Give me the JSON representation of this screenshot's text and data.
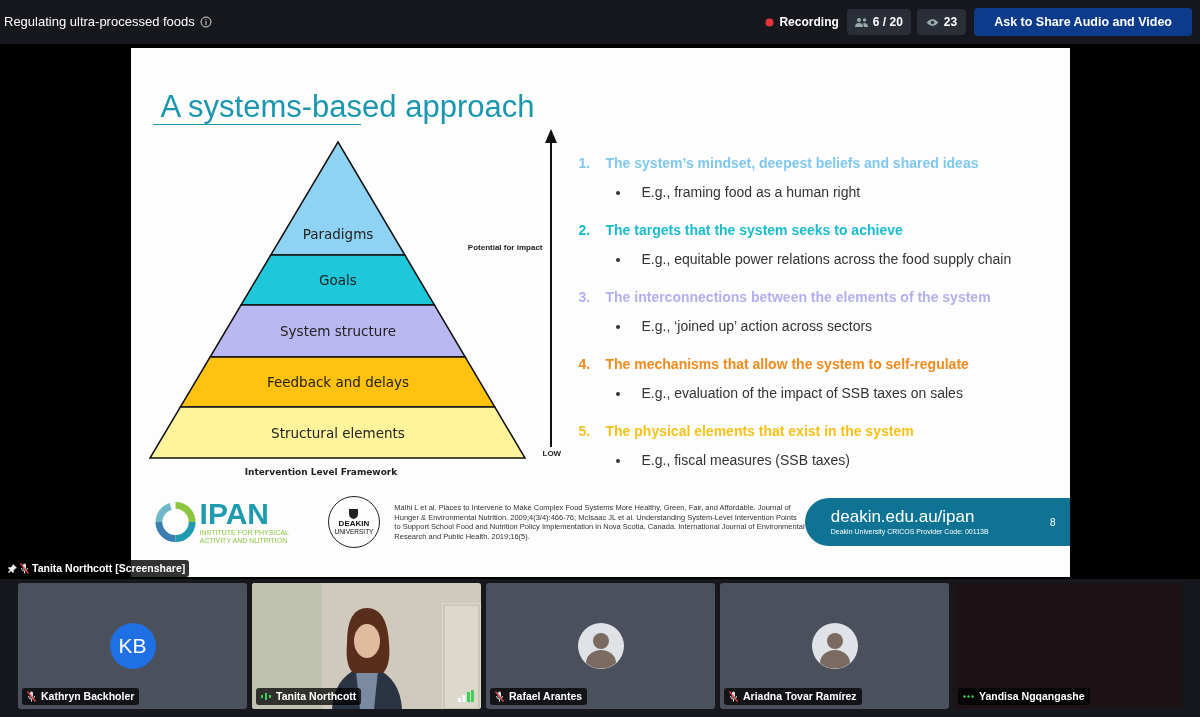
{
  "meeting": {
    "title": "Regulating ultra-processed foods",
    "recording": "Recording",
    "participants": "6 / 20",
    "viewers": "23",
    "share_button": "Ask to Share Audio and Video"
  },
  "slide": {
    "title": "A systems-based approach",
    "pyramid": [
      {
        "label": "Paradigms",
        "color": "#8fd3f4"
      },
      {
        "label": "Goals",
        "color": "#1ec8da"
      },
      {
        "label": "System structure",
        "color": "#bab8f0"
      },
      {
        "label": "Feedback and delays",
        "color": "#ffc20e"
      },
      {
        "label": "Structural elements",
        "color": "#fff39c"
      }
    ],
    "axis_label": "Potential for impact",
    "axis_low": "LOW",
    "caption": "Intervention Level Framework",
    "points": [
      {
        "number": "1.",
        "heading": "The system’s mindset, deepest beliefs and shared ideas",
        "example": "E.g., framing food as a human right",
        "color": "#7fc8ef"
      },
      {
        "number": "2.",
        "heading": "The targets that the system seeks to achieve",
        "example": "E.g., equitable power relations across the food supply chain",
        "color": "#19bccd"
      },
      {
        "number": "3.",
        "heading": "The interconnections between the elements of the system",
        "example": "E.g., ‘joined up’ action across sectors",
        "color": "#b2b0ec"
      },
      {
        "number": "4.",
        "heading": "The mechanisms that allow the system to self-regulate",
        "example": "E.g., evaluation of the impact of SSB taxes on sales",
        "color": "#f08a1c"
      },
      {
        "number": "5.",
        "heading": "The physical elements that exist in the system",
        "example": "E.g., fiscal measures (SSB taxes)",
        "color": "#f5c21a"
      }
    ],
    "ipan": "IPAN",
    "ipan_subtitle": "INSTITUTE FOR PHYSICAL ACTIVITY AND NUTRITION",
    "deakin": "DEAKIN",
    "deakin_sub": "UNIVERSITY",
    "references": "Malhi L et al. Places to Intervene to Make Complex Food Systems More Healthy, Green, Fair, and Affordable. Journal of Hunger & Environmental Nutrition. 2009;4(3/4):466-76; McIsaac JL et al. Understanding System-Level Intervention Points to Support School Food and Nutrition Policy Implementation in Nova Scotia, Canada. International Journal of Environmental Research and Public Health. 2019;16(5).",
    "url": "deakin.edu.au/ipan",
    "cricos": "Deakin University CRICOS Provider Code: 00113B",
    "page": "8"
  },
  "presenter_label": "Tanita Northcott [Screenshare]",
  "tiles": [
    {
      "name": "Kathryn Backholer",
      "kind": "initials",
      "initials": "KB",
      "muted": true,
      "speaking": false
    },
    {
      "name": "Tanita Northcott",
      "kind": "video",
      "muted": false,
      "speaking": true
    },
    {
      "name": "Rafael Arantes",
      "kind": "avatar",
      "muted": true,
      "speaking": false
    },
    {
      "name": "Ariadna Tovar Ramírez",
      "kind": "avatar",
      "muted": true,
      "speaking": false
    },
    {
      "name": "Yandisa Ngqangashe",
      "kind": "blank",
      "muted": false,
      "speaking": false
    }
  ]
}
